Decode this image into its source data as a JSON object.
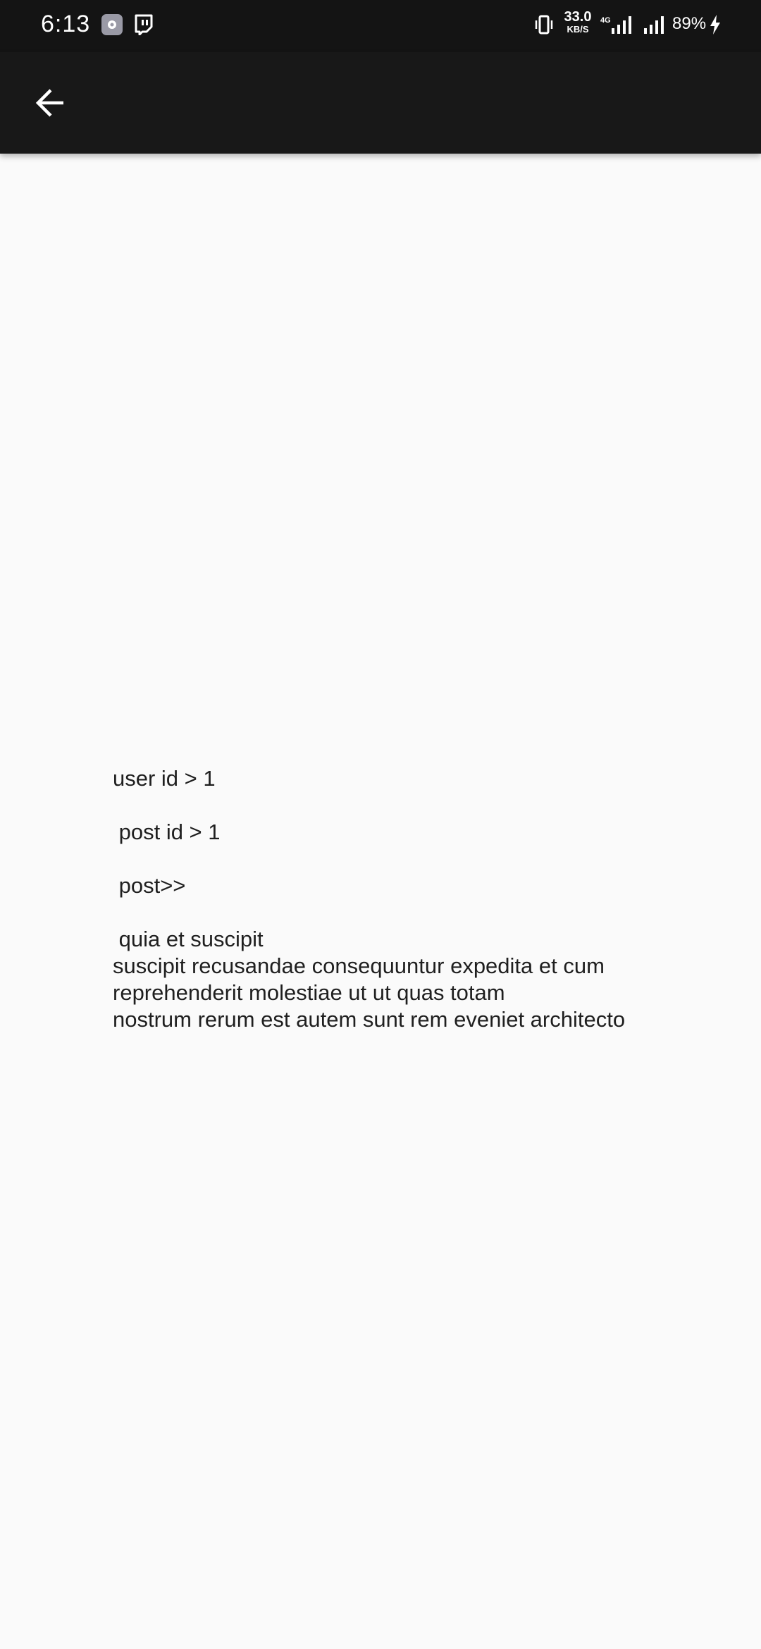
{
  "status_bar": {
    "time": "6:13",
    "net_speed_value": "33.0",
    "net_speed_unit": "KB/S",
    "network_type": "4G",
    "battery": "89%",
    "icons": [
      "settings-notification-icon",
      "twitch-icon",
      "vibrate-icon",
      "signal-4g-icon",
      "signal-icon",
      "charging-icon"
    ]
  },
  "app_bar": {
    "back_icon": "arrow-left-icon"
  },
  "content": {
    "user_id_line": "user id > 1",
    "post_id_line": " post id > 1",
    "post_label_line": " post>>",
    "post_body": " quia et suscipit\nsuscipit recusandae consequuntur expedita et cum\nreprehenderit molestiae ut ut quas totam\nnostrum rerum est autem sunt rem eveniet architecto"
  },
  "colors": {
    "status_bar_bg": "#141414",
    "app_bar_bg": "#181818",
    "page_bg": "#fafafa",
    "text": "#1f1f1f"
  }
}
